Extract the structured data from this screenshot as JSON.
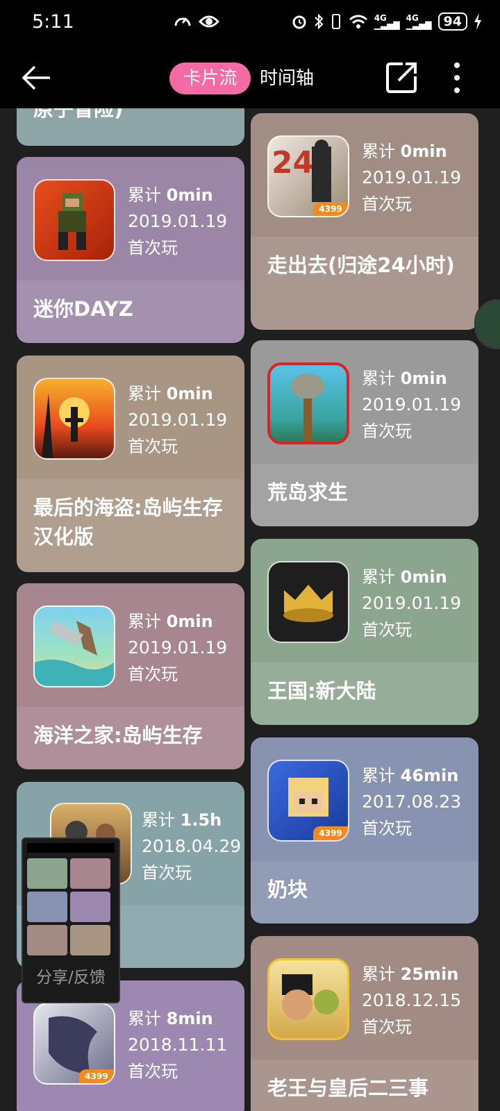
{
  "status_bar": {
    "time": "5:11",
    "battery": "94",
    "net1": "4G",
    "net2": "4G"
  },
  "app_bar": {
    "tabs": [
      {
        "label": "卡片流",
        "active": true
      },
      {
        "label": "时间轴",
        "active": false
      }
    ]
  },
  "cards": [
    {
      "title": "原子冒险)",
      "color": "#8ea5a8"
    },
    {
      "title": "迷你DAYZ",
      "total_label": "累计",
      "total_value": "0min",
      "date": "2019.01.19",
      "first_play": "首次玩",
      "color": "#9b86a8"
    },
    {
      "title": "最后的海盗:岛屿生存汉化版",
      "total_label": "累计",
      "total_value": "0min",
      "date": "2019.01.19",
      "first_play": "首次玩",
      "color": "#a99584"
    },
    {
      "title": "海洋之家:岛屿生存",
      "total_label": "累计",
      "total_value": "0min",
      "date": "2019.01.19",
      "first_play": "首次玩",
      "color": "#a88690"
    },
    {
      "title": "",
      "total_label": "累计",
      "total_value": "1.5h",
      "date": "2018.04.29",
      "first_play": "首次玩",
      "color": "#86a3a8"
    },
    {
      "title": "",
      "total_label": "累计",
      "total_value": "8min",
      "date": "2018.11.11",
      "first_play": "首次玩",
      "color": "#9c88b0"
    },
    {
      "title": "走出去(归途24小时)",
      "total_label": "累计",
      "total_value": "0min",
      "date": "2019.01.19",
      "first_play": "首次玩",
      "color": "#a28d84"
    },
    {
      "title": "荒岛求生",
      "total_label": "累计",
      "total_value": "0min",
      "date": "2019.01.19",
      "first_play": "首次玩",
      "color": "#9a9a9a"
    },
    {
      "title": "王国:新大陆",
      "total_label": "累计",
      "total_value": "0min",
      "date": "2019.01.19",
      "first_play": "首次玩",
      "color": "#8ca58f"
    },
    {
      "title": "奶块",
      "total_label": "累计",
      "total_value": "46min",
      "date": "2017.08.23",
      "first_play": "首次玩",
      "color": "#8793b0"
    },
    {
      "title": "老王与皇后二三事",
      "total_label": "累计",
      "total_value": "25min",
      "date": "2018.12.15",
      "first_play": "首次玩",
      "color": "#a28b84"
    }
  ],
  "floating_window": {
    "label": "分享/反馈"
  },
  "badge": "4399"
}
